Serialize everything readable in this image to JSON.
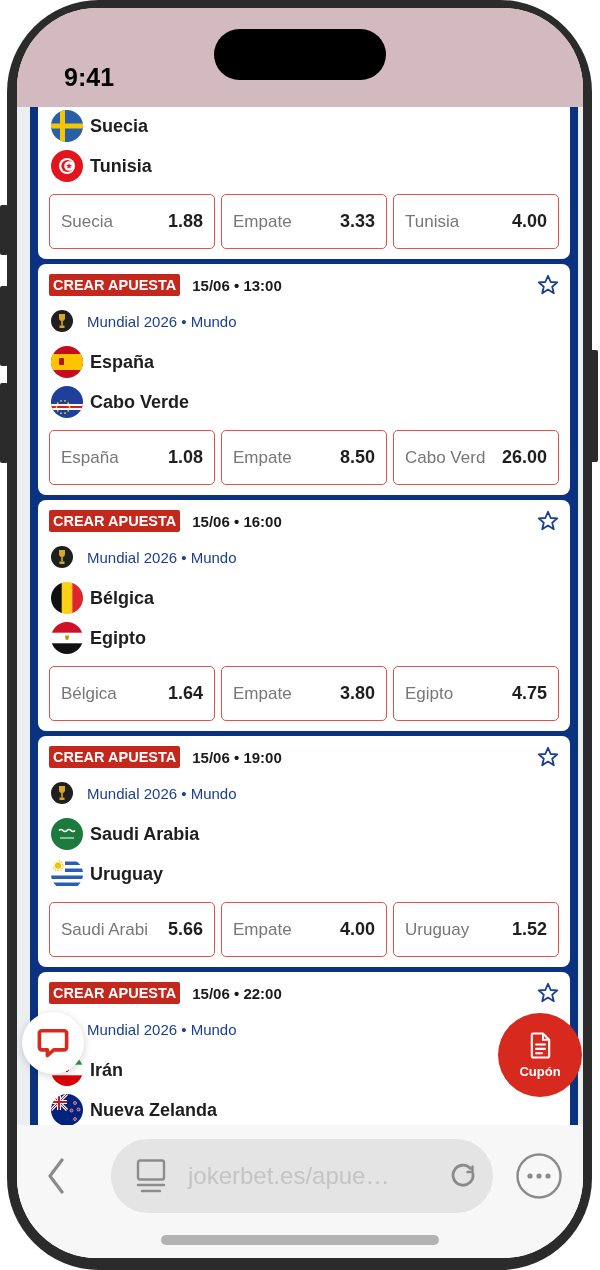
{
  "status_bar": {
    "time": "9:41"
  },
  "matches": [
    {
      "teams": [
        {
          "name": "Suecia",
          "kind": "sweden"
        },
        {
          "name": "Tunisia",
          "kind": "tunisia"
        }
      ],
      "odds": [
        {
          "label": "Suecia",
          "value": "1.88",
          "selected": false
        },
        {
          "label": "Empate",
          "value": "3.33",
          "selected": false
        },
        {
          "label": "Tunisia",
          "value": "4.00",
          "selected": false
        }
      ]
    },
    {
      "badge": "CREAR APUESTA",
      "datetime": "15/06 • 13:00",
      "favorite": false,
      "league": "Mundial 2026 • Mundo",
      "teams": [
        {
          "name": "España",
          "kind": "spain"
        },
        {
          "name": "Cabo Verde",
          "kind": "capeverde"
        }
      ],
      "odds": [
        {
          "label": "España",
          "value": "1.08",
          "selected": false
        },
        {
          "label": "Empate",
          "value": "8.50",
          "selected": false
        },
        {
          "label": "Cabo Verd",
          "value": "26.00",
          "selected": false
        }
      ]
    },
    {
      "badge": "CREAR APUESTA",
      "datetime": "15/06 • 16:00",
      "favorite": false,
      "league": "Mundial 2026 • Mundo",
      "teams": [
        {
          "name": "Bélgica",
          "kind": "belgium"
        },
        {
          "name": "Egipto",
          "kind": "egypt"
        }
      ],
      "odds": [
        {
          "label": "Bélgica",
          "value": "1.64",
          "selected": false
        },
        {
          "label": "Empate",
          "value": "3.80",
          "selected": false
        },
        {
          "label": "Egipto",
          "value": "4.75",
          "selected": false
        }
      ]
    },
    {
      "badge": "CREAR APUESTA",
      "datetime": "15/06 • 19:00",
      "favorite": false,
      "league": "Mundial 2026 • Mundo",
      "teams": [
        {
          "name": "Saudi Arabia",
          "kind": "saudiarabia"
        },
        {
          "name": "Uruguay",
          "kind": "uruguay"
        }
      ],
      "odds": [
        {
          "label": "Saudi Arabi",
          "value": "5.66",
          "selected": false
        },
        {
          "label": "Empate",
          "value": "4.00",
          "selected": false
        },
        {
          "label": "Uruguay",
          "value": "1.52",
          "selected": false
        }
      ]
    },
    {
      "badge": "CREAR APUESTA",
      "datetime": "15/06 • 22:00",
      "favorite": false,
      "league": "Mundial 2026 • Mundo",
      "teams": [
        {
          "name": "Irán",
          "kind": "iran"
        },
        {
          "name": "Nueva Zelanda",
          "kind": "newzealand"
        }
      ]
    }
  ],
  "coupon_button": {
    "label": "Cupón"
  },
  "browser_toolbar": {
    "url": "jokerbet.es/apue…"
  }
}
